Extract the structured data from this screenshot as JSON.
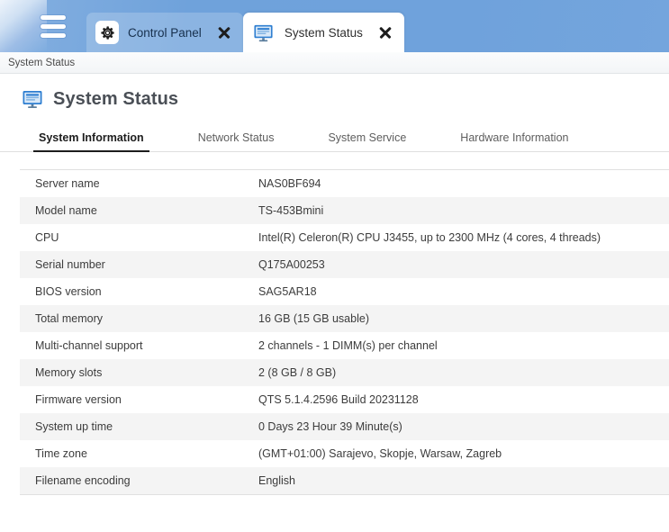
{
  "window": {
    "menu_icon": "hamburger-menu-icon",
    "tabs": [
      {
        "id": "control-panel",
        "label": "Control Panel",
        "icon": "gear-icon",
        "close_icon": "close-icon",
        "active": false
      },
      {
        "id": "system-status",
        "label": "System Status",
        "icon": "monitor-icon",
        "close_icon": "close-icon",
        "active": true
      }
    ]
  },
  "breadcrumb": {
    "text": "System Status"
  },
  "page": {
    "icon": "monitor-icon",
    "title": "System Status"
  },
  "nav_tabs": {
    "items": [
      {
        "label": "System Information",
        "selected": true
      },
      {
        "label": "Network Status",
        "selected": false
      },
      {
        "label": "System Service",
        "selected": false
      },
      {
        "label": "Hardware Information",
        "selected": false
      }
    ]
  },
  "system_information": {
    "rows": [
      {
        "label": "Server name",
        "value": "NAS0BF694"
      },
      {
        "label": "Model name",
        "value": "TS-453Bmini"
      },
      {
        "label": "CPU",
        "value": "Intel(R) Celeron(R) CPU J3455, up to 2300 MHz (4 cores, 4 threads)"
      },
      {
        "label": "Serial number",
        "value": "Q175A00253"
      },
      {
        "label": "BIOS version",
        "value": "SAG5AR18"
      },
      {
        "label": "Total memory",
        "value": "16 GB (15 GB usable)"
      },
      {
        "label": "Multi-channel support",
        "value": "2 channels - 1 DIMM(s) per channel"
      },
      {
        "label": "Memory slots",
        "value": "2 (8 GB / 8 GB)"
      },
      {
        "label": "Firmware version",
        "value": "QTS 5.1.4.2596 Build 20231128"
      },
      {
        "label": "System up time",
        "value": "0 Days 23 Hour 39 Minute(s)"
      },
      {
        "label": "Time zone",
        "value": "(GMT+01:00) Sarajevo, Skopje, Warsaw, Zagreb"
      },
      {
        "label": "Filename encoding",
        "value": "English"
      }
    ]
  },
  "colors": {
    "topbar_blue": "#6fa2db",
    "active_tab_bg": "#ffffff",
    "row_stripe": "#f4f4f4",
    "icon_blue": "#2f7fd1",
    "title_gray": "#4a4f56"
  }
}
